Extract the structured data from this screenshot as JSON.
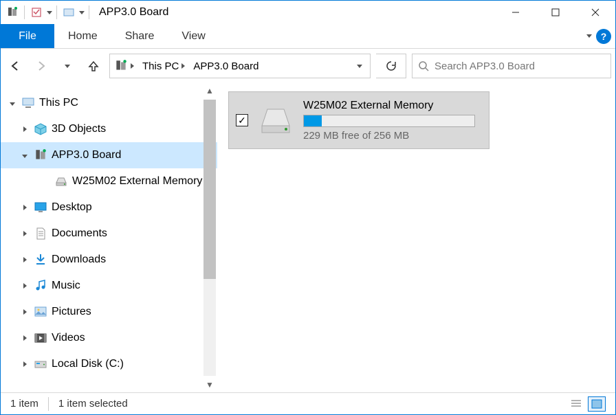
{
  "titlebar": {
    "title": "APP3.0 Board"
  },
  "ribbon": {
    "file": "File",
    "tabs": [
      "Home",
      "Share",
      "View"
    ]
  },
  "breadcrumb": {
    "segments": [
      "This PC",
      "APP3.0 Board"
    ]
  },
  "search": {
    "placeholder": "Search APP3.0 Board"
  },
  "tree": {
    "root": "This PC",
    "items": [
      {
        "label": "3D Objects"
      },
      {
        "label": "APP3.0 Board",
        "selected": true,
        "expanded": true,
        "children": [
          {
            "label": "W25M02 External Memory"
          }
        ]
      },
      {
        "label": "Desktop"
      },
      {
        "label": "Documents"
      },
      {
        "label": "Downloads"
      },
      {
        "label": "Music"
      },
      {
        "label": "Pictures"
      },
      {
        "label": "Videos"
      },
      {
        "label": "Local Disk (C:)"
      }
    ]
  },
  "content": {
    "drive": {
      "name": "W25M02 External Memory",
      "status": "229 MB free of 256 MB",
      "used_fraction": 0.105,
      "checked": true
    }
  },
  "statusbar": {
    "count": "1 item",
    "selected": "1 item selected"
  }
}
